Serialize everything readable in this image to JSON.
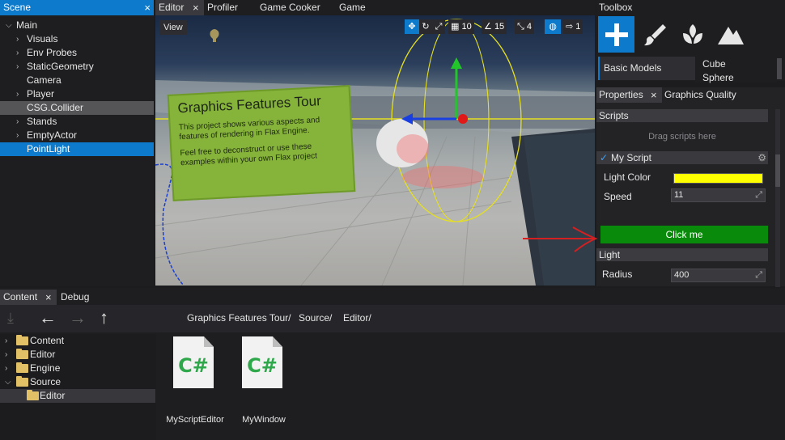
{
  "scene": {
    "tab_label": "Scene",
    "close": "×",
    "items": [
      {
        "label": "Main",
        "level": 0,
        "expander": "⌵"
      },
      {
        "label": "Visuals",
        "level": 1,
        "expander": "›"
      },
      {
        "label": "Env Probes",
        "level": 1,
        "expander": "›"
      },
      {
        "label": "StaticGeometry",
        "level": 1,
        "expander": "›"
      },
      {
        "label": "Camera",
        "level": 1,
        "expander": ""
      },
      {
        "label": "Player",
        "level": 1,
        "expander": "›"
      },
      {
        "label": "CSG.Collider",
        "level": 1,
        "expander": ""
      },
      {
        "label": "Stands",
        "level": 1,
        "expander": "›"
      },
      {
        "label": "EmptyActor",
        "level": 1,
        "expander": "›"
      },
      {
        "label": "PointLight",
        "level": 1,
        "expander": ""
      }
    ]
  },
  "editor_tabs": {
    "editor": "Editor",
    "close": "×",
    "profiler": "Profiler",
    "game_cooker": "Game Cooker",
    "game": "Game"
  },
  "viewport": {
    "view_button": "View",
    "grid_value": "10",
    "angle_value": "15",
    "scale_value": "4",
    "speed_value": "1",
    "sign_title": "Graphics Features Tour",
    "sign_text_1": "This project shows various aspects and features of rendering in Flax Engine.",
    "sign_text_2": "Feel free to deconstruct or use these examples within your own Flax project"
  },
  "toolbox": {
    "title": "Toolbox",
    "category": "Basic Models",
    "models": [
      "Cube",
      "Sphere"
    ]
  },
  "properties": {
    "tab_properties": "Properties",
    "close": "×",
    "tab_graphics_quality": "Graphics Quality",
    "scripts_header": "Scripts",
    "drag_hint": "Drag scripts here",
    "script_name": "My Script",
    "script_check": "✓",
    "light_color_label": "Light Color",
    "light_color_value": "#ffff00",
    "speed_label": "Speed",
    "speed_value": "11",
    "click_button": "Click me",
    "light_header": "Light",
    "radius_label": "Radius",
    "radius_value": "400"
  },
  "content": {
    "tab_content": "Content",
    "close": "×",
    "tab_debug": "Debug",
    "path": [
      "Graphics Features Tour/",
      "Source/",
      "Editor/"
    ],
    "tree": [
      {
        "label": "Content",
        "expander": "›"
      },
      {
        "label": "Editor",
        "expander": "›"
      },
      {
        "label": "Engine",
        "expander": "›"
      },
      {
        "label": "Source",
        "expander": "⌵"
      },
      {
        "label": "Editor",
        "expander": ""
      }
    ],
    "files": [
      {
        "name": "MyScriptEditor",
        "icon": "C#"
      },
      {
        "name": "MyWindow",
        "icon": "C#"
      }
    ]
  },
  "colors": {
    "accent": "#0e7acc",
    "button_green": "#0a8a0a",
    "sign_green": "#86b33a"
  }
}
